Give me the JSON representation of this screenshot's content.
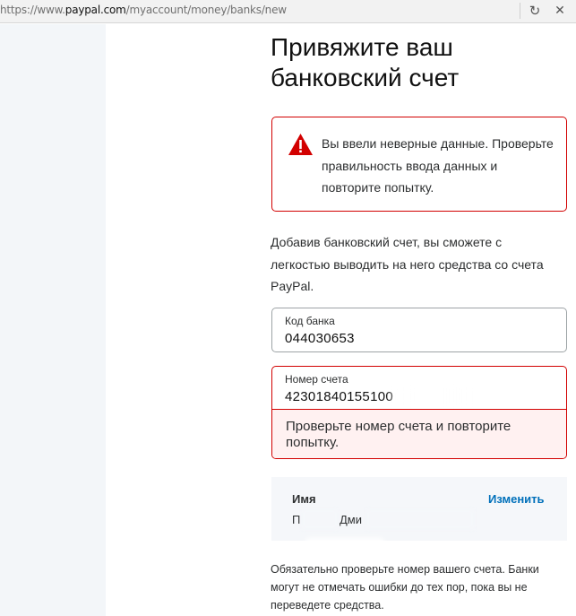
{
  "browser": {
    "url_prefix": "https://www.",
    "url_host": "paypal.com",
    "url_path": "/myaccount/money/banks/new",
    "reload_icon": "reload-icon",
    "stop_icon": "stop-icon"
  },
  "page": {
    "title": "Привяжите ваш банковский счет",
    "alert": {
      "icon": "warning-icon",
      "color": "#d20000",
      "message": "Вы ввели неверные данные. Проверьте правильность ввода данных и повторите попытку."
    },
    "intro": "Добавив банковский счет, вы сможете с легкостью выводить на него средства со счета PayPal."
  },
  "form": {
    "bank_code": {
      "label": "Код банка",
      "value": "044030653"
    },
    "account_number": {
      "label": "Номер счета",
      "value": "42301840155100",
      "error": "Проверьте номер счета и повторите попытку."
    },
    "name": {
      "label": "Имя",
      "change_label": "Изменить",
      "value_first": "П",
      "value_second": "Дми"
    }
  },
  "note": "Обязательно проверьте номер вашего счета. Банки могут не отмечать ошибки до тех пор, пока вы не переведете средства.",
  "colors": {
    "error": "#d20000",
    "error_bg": "#fff1f1",
    "link": "#0070ba",
    "sidebar": "#f3f6f9"
  }
}
